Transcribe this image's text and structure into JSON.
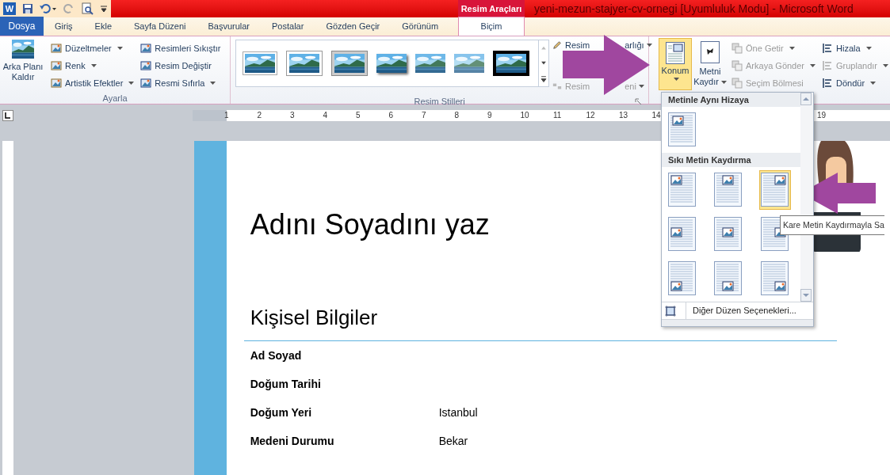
{
  "window": {
    "app_letter": "W",
    "contextual_tab_group": "Resim Araçları",
    "title": "yeni-mezun-stajyer-cv-ornegi [Uyumluluk Modu]  -  Microsoft Word"
  },
  "tabs": [
    {
      "label": "Dosya",
      "kind": "file",
      "selected": false
    },
    {
      "label": "Giriş",
      "kind": "tab",
      "selected": false
    },
    {
      "label": "Ekle",
      "kind": "tab",
      "selected": false
    },
    {
      "label": "Sayfa Düzeni",
      "kind": "tab",
      "selected": false
    },
    {
      "label": "Başvurular",
      "kind": "tab",
      "selected": false
    },
    {
      "label": "Postalar",
      "kind": "tab",
      "selected": false
    },
    {
      "label": "Gözden Geçir",
      "kind": "tab",
      "selected": false
    },
    {
      "label": "Görünüm",
      "kind": "tab",
      "selected": false
    },
    {
      "label": "Biçim",
      "kind": "tab",
      "selected": true
    }
  ],
  "ribbon": {
    "adjust": {
      "label": "Ayarla",
      "remove_bg": "Arka Planı Kaldır",
      "col1": [
        {
          "label": "Düzeltmeler",
          "menu": true
        },
        {
          "label": "Renk",
          "menu": true
        },
        {
          "label": "Artistik Efektler",
          "menu": true
        }
      ],
      "col2": [
        {
          "label": "Resimleri Sıkıştır",
          "menu": false
        },
        {
          "label": "Resim Değiştir",
          "menu": false
        },
        {
          "label": "Resmi Sıfırla",
          "menu": true
        }
      ]
    },
    "styles": {
      "label": "Resim Stilleri",
      "thumbs": [
        {
          "kind": "plain"
        },
        {
          "kind": "white-frame"
        },
        {
          "kind": "gray-frame"
        },
        {
          "kind": "shadow"
        },
        {
          "kind": "soft"
        },
        {
          "kind": "fade"
        },
        {
          "kind": "black-frame"
        }
      ],
      "border_left": "Resim",
      "border_right": "arlığı",
      "layout_left": "Resim",
      "layout_right": "eni"
    },
    "arrange": {
      "position": {
        "label": "Konum",
        "selected": true
      },
      "wrap": {
        "line1": "Metni",
        "line2": "Kaydır"
      },
      "col1": [
        {
          "label": "Öne Getir",
          "disabled": true,
          "menu": true
        },
        {
          "label": "Arkaya Gönder",
          "disabled": true,
          "menu": true
        },
        {
          "label": "Seçim Bölmesi",
          "disabled": true,
          "menu": false
        }
      ],
      "col2": [
        {
          "label": "Hizala",
          "disabled": false,
          "menu": true
        },
        {
          "label": "Gruplandır",
          "disabled": true,
          "menu": true
        },
        {
          "label": "Döndür",
          "disabled": false,
          "menu": true
        }
      ]
    }
  },
  "ruler": {
    "numbers": [
      "1",
      "2",
      "3",
      "4",
      "5",
      "6",
      "7",
      "8",
      "9",
      "10",
      "11",
      "12",
      "13",
      "14"
    ],
    "right_number": "19"
  },
  "position_menu": {
    "sections": [
      {
        "title": "Metinle Aynı Hizaya",
        "items": [
          {
            "kind": "inline",
            "selected": false
          }
        ]
      },
      {
        "title": "Sıkı Metin Kaydırma",
        "items": [
          {
            "kind": "top-left",
            "selected": false
          },
          {
            "kind": "top-center",
            "selected": false
          },
          {
            "kind": "top-right",
            "selected": true
          },
          {
            "kind": "middle-left",
            "selected": false
          },
          {
            "kind": "middle-center",
            "selected": false
          },
          {
            "kind": "middle-right",
            "selected": false
          },
          {
            "kind": "bottom-left",
            "selected": false
          },
          {
            "kind": "bottom-center",
            "selected": false
          },
          {
            "kind": "bottom-right",
            "selected": false
          }
        ]
      }
    ],
    "more": "Diğer Düzen Seçenekleri...",
    "tooltip": "Kare Metin Kaydırmayla Sa"
  },
  "document": {
    "name": "Adını Soyadını yaz",
    "section": "Kişisel Bilgiler",
    "rows": [
      {
        "label": "Ad Soyad"
      },
      {
        "label": "Doğum Tarihi"
      },
      {
        "label": "Doğum Yeri",
        "value": "Istanbul"
      },
      {
        "label": "Medeni Durumu",
        "value": "Bekar"
      }
    ]
  }
}
